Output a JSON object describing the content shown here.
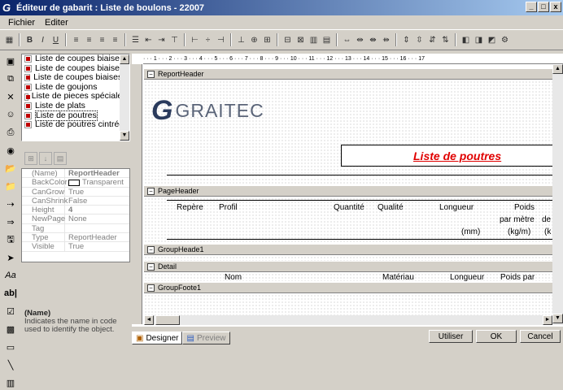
{
  "window": {
    "title": "Éditeur de gabarit : Liste de boulons - 22007",
    "min": "_",
    "max": "□",
    "close": "x"
  },
  "menu": [
    "Fichier",
    "Editer"
  ],
  "list": {
    "items": [
      "Liste de coupes biaises",
      "Liste de coupes biaises",
      "Liste de coupes biaisesnt",
      "Liste de goujons",
      "Liste de pieces spécialent",
      "Liste de plats",
      "Liste de poutres",
      "Liste de poutres cintrée"
    ],
    "selected": 6
  },
  "props": {
    "rows": [
      {
        "k": "(Name)",
        "v": "ReportHeader"
      },
      {
        "k": "BackColor",
        "v": "Transparent"
      },
      {
        "k": "CanGrow",
        "v": "True"
      },
      {
        "k": "CanShrink",
        "v": "False"
      },
      {
        "k": "Height",
        "v": "4"
      },
      {
        "k": "NewPage",
        "v": "None"
      },
      {
        "k": "Tag",
        "v": ""
      },
      {
        "k": "Type",
        "v": "ReportHeader"
      },
      {
        "k": "Visible",
        "v": "True"
      }
    ]
  },
  "help": {
    "title": "(Name)",
    "text": "Indicates the name in code used to identify the object."
  },
  "ruler": "· · · 1 · · · 2 · · · 3 · · · 4 · · · 5 · · · 6 · · · 7 · · · 8 · · · 9 · · · 10 · · · 11 · · · 12 · · · 13 · · · 14 · · · 15 · · · 16 · · · 17",
  "bands": {
    "report_header": "ReportHeader",
    "page_header": "PageHeader",
    "group_header": "GroupHeade1",
    "detail": "Detail",
    "group_footer": "GroupFoote1"
  },
  "logo": {
    "mark": "G",
    "word": "GRAITEC"
  },
  "report_title": "Liste de poutres",
  "page_header": {
    "repere": "Repère",
    "profil": "Profil",
    "quantite": "Quantité",
    "qualite": "Qualité",
    "longueur": "Longueur",
    "poids": "Poids",
    "par_metre": "par mètre",
    "de": "de",
    "mm": "(mm)",
    "kgm": "(kg/m)",
    "paren": "(k"
  },
  "detail": {
    "nom": "Nom",
    "materiau": "Matériau",
    "longueur": "Longueur",
    "poids_par": "Poids par"
  },
  "tabs": {
    "designer": "Designer",
    "preview": "Preview"
  },
  "buttons": {
    "utiliser": "Utiliser",
    "ok": "OK",
    "cancel": "Cancel"
  },
  "colors": {
    "title_red": "#e00000",
    "titlebar": "#0a246a"
  }
}
